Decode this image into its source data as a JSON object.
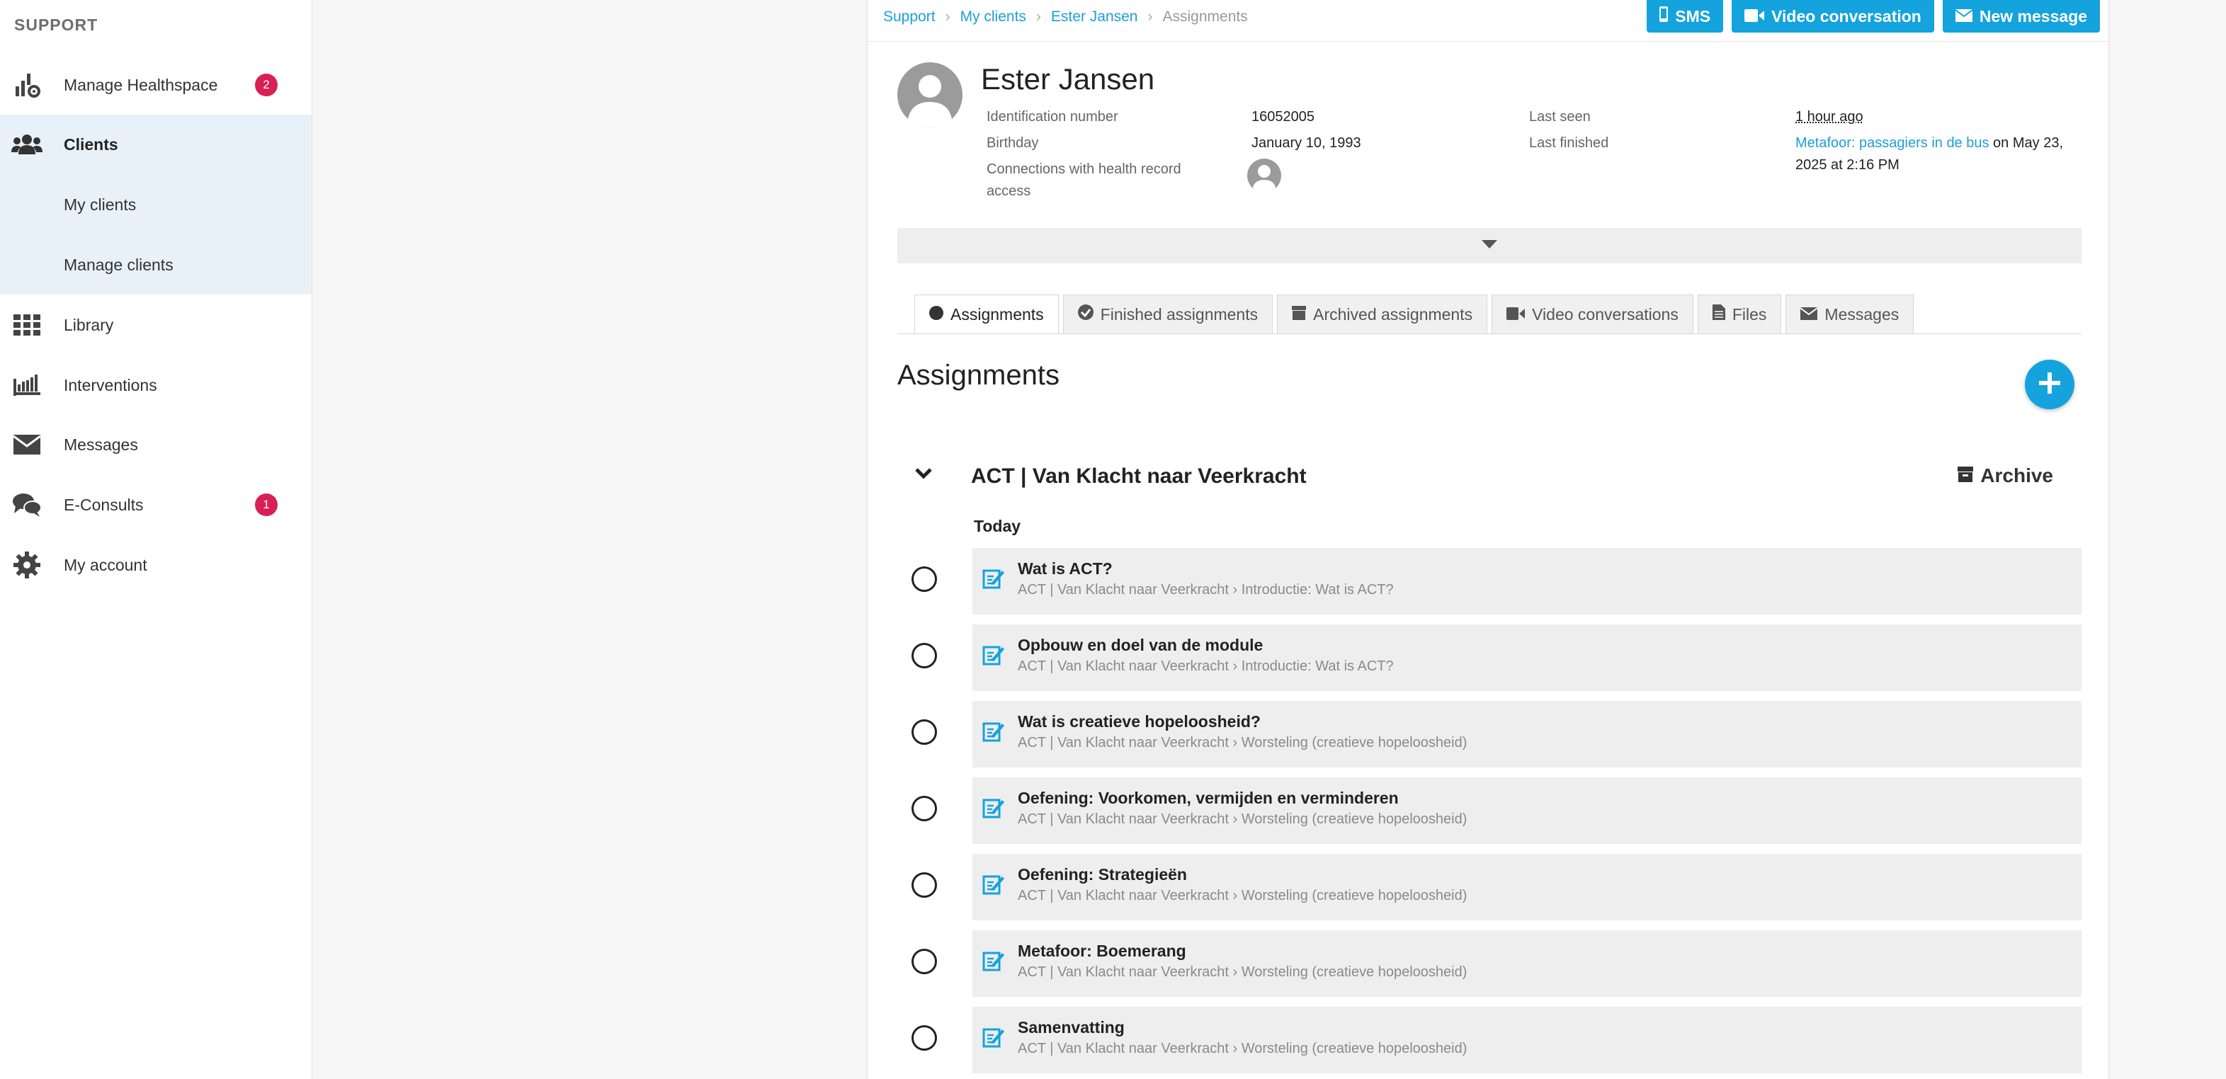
{
  "sidebar": {
    "heading": "SUPPORT",
    "items": [
      {
        "label": "Manage Healthspace",
        "icon": "manage-healthspace-icon",
        "badge": "2"
      },
      {
        "label": "Clients",
        "icon": "clients-icon"
      },
      {
        "label": "My clients"
      },
      {
        "label": "Manage clients"
      },
      {
        "label": "Library",
        "icon": "grid-icon"
      },
      {
        "label": "Interventions",
        "icon": "interventions-icon"
      },
      {
        "label": "Messages",
        "icon": "envelope-icon"
      },
      {
        "label": "E-Consults",
        "icon": "chat-icon",
        "badge": "1"
      },
      {
        "label": "My account",
        "icon": "gear-icon"
      }
    ]
  },
  "breadcrumb": {
    "items": [
      "Support",
      "My clients",
      "Ester Jansen",
      "Assignments"
    ],
    "separator": "›"
  },
  "actions": {
    "sms": "SMS",
    "video": "Video conversation",
    "message": "New message"
  },
  "client": {
    "name": "Ester Jansen",
    "id_label": "Identification number",
    "id_value": "16052005",
    "birthday_label": "Birthday",
    "birthday_value": "January 10, 1993",
    "connections_label": "Connections with health record access",
    "last_seen_label": "Last seen",
    "last_seen_value": "1 hour ago",
    "last_finished_label": "Last finished",
    "last_finished_link": "Metafoor: passagiers in de bus",
    "last_finished_suffix": " on May 23, 2025 at 2:16 PM"
  },
  "tabs": [
    {
      "label": "Assignments",
      "icon": "dot-icon",
      "active": true
    },
    {
      "label": "Finished assignments",
      "icon": "check-circle-icon"
    },
    {
      "label": "Archived assignments",
      "icon": "archive-icon"
    },
    {
      "label": "Video conversations",
      "icon": "video-icon"
    },
    {
      "label": "Files",
      "icon": "file-icon"
    },
    {
      "label": "Messages",
      "icon": "envelope-icon"
    }
  ],
  "section": {
    "title": "Assignments",
    "module_title": "ACT | Van Klacht naar Veerkracht",
    "archive_label": "Archive",
    "group_label": "Today"
  },
  "assignments": [
    {
      "title": "Wat is ACT?",
      "path": "ACT | Van Klacht naar Veerkracht › Introductie: Wat is ACT?"
    },
    {
      "title": "Opbouw en doel van de module",
      "path": "ACT | Van Klacht naar Veerkracht › Introductie: Wat is ACT?"
    },
    {
      "title": "Wat is creatieve hopeloosheid?",
      "path": "ACT | Van Klacht naar Veerkracht › Worsteling (creatieve hopeloosheid)"
    },
    {
      "title": "Oefening: Voorkomen, vermijden en verminderen",
      "path": "ACT | Van Klacht naar Veerkracht › Worsteling (creatieve hopeloosheid)"
    },
    {
      "title": "Oefening: Strategieën",
      "path": "ACT | Van Klacht naar Veerkracht › Worsteling (creatieve hopeloosheid)"
    },
    {
      "title": "Metafoor: Boemerang",
      "path": "ACT | Van Klacht naar Veerkracht › Worsteling (creatieve hopeloosheid)"
    },
    {
      "title": "Samenvatting",
      "path": "ACT | Van Klacht naar Veerkracht › Worsteling (creatieve hopeloosheid)"
    }
  ],
  "colors": {
    "accent": "#14a3dc",
    "badge": "#d81f56",
    "sidebar_active_bg": "#e9f1f8",
    "card_bg": "#eeeeee"
  }
}
